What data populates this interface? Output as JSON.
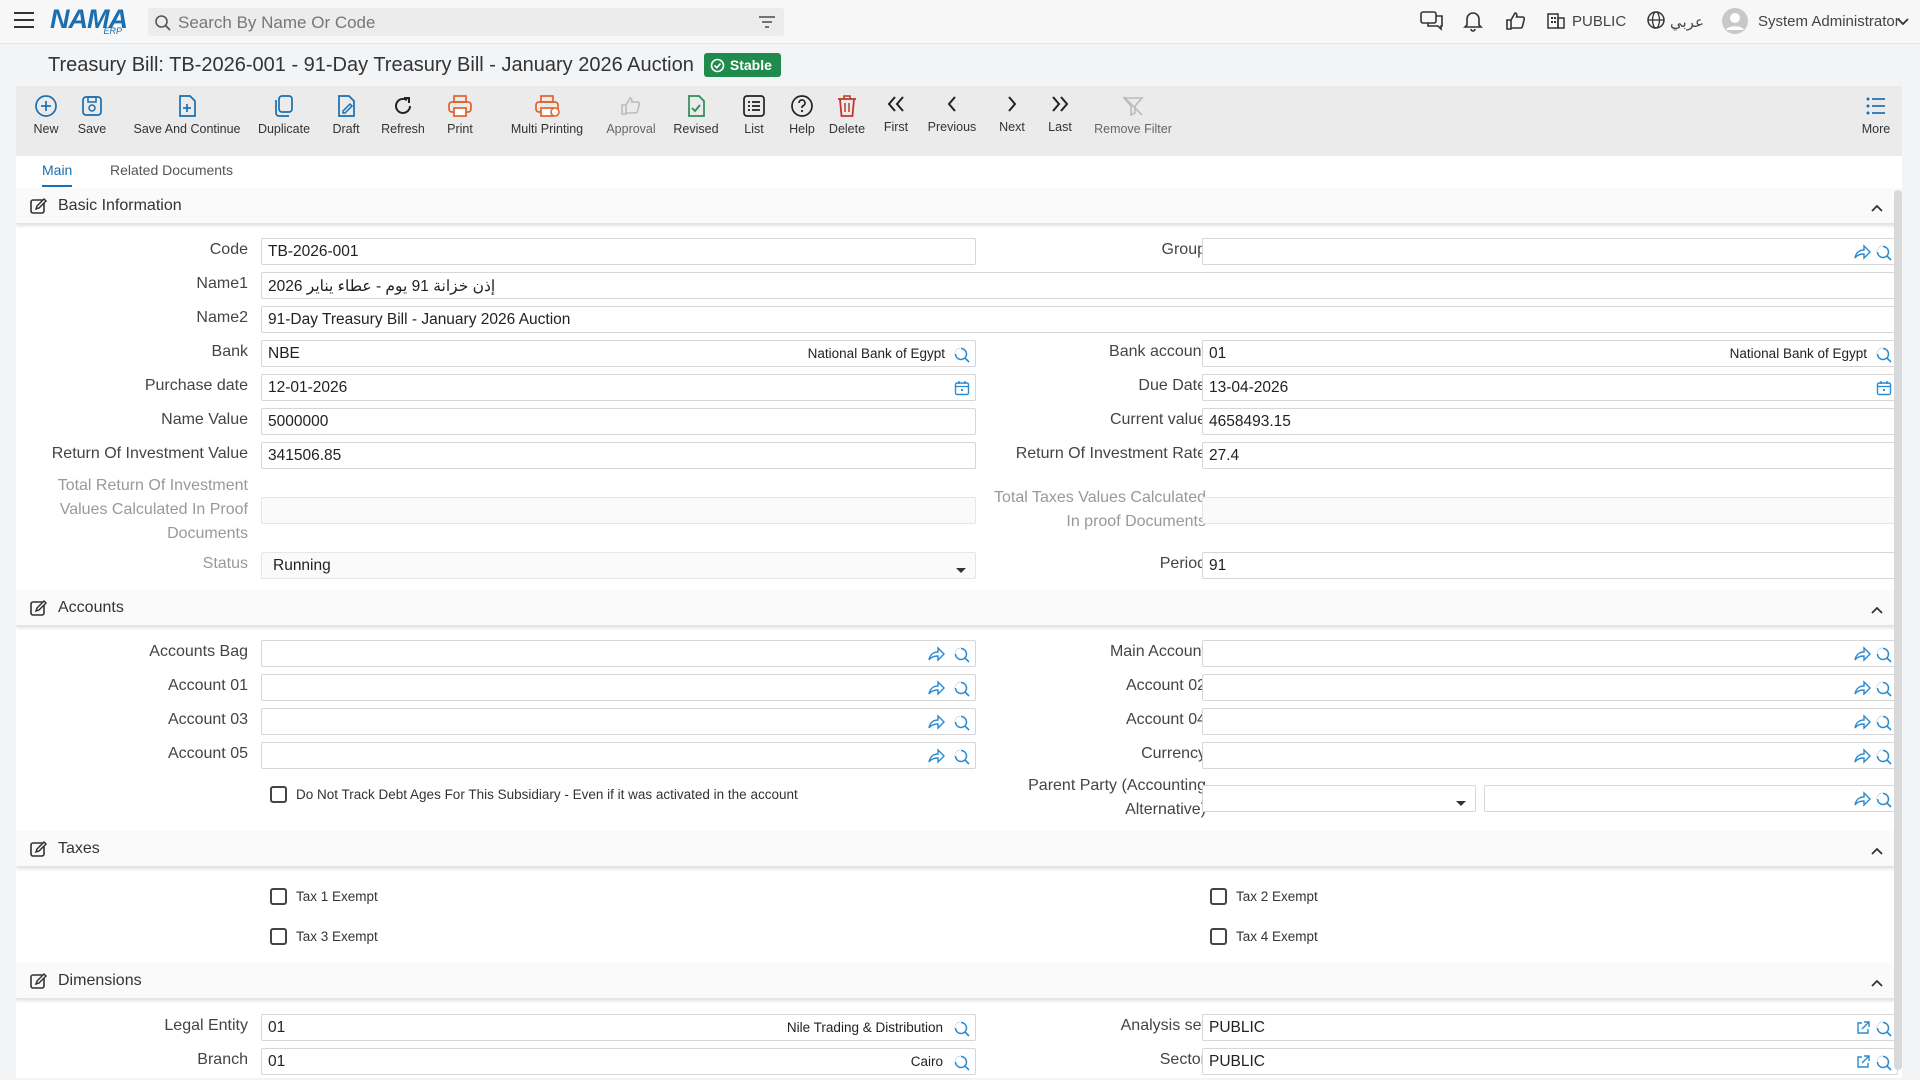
{
  "app": {
    "logo": "NAMA",
    "logo_sub": "ERP",
    "search_placeholder": "Search By Name Or Code",
    "company": "PUBLIC",
    "language": "عربي",
    "user": "System Administrator"
  },
  "page": {
    "title": "Treasury Bill: TB-2026-001 - 91-Day Treasury Bill - January 2026 Auction",
    "status_badge": "Stable",
    "status_color": "#1f8b4c"
  },
  "toolbar": {
    "new": "New",
    "save": "Save",
    "save_continue": "Save And Continue",
    "duplicate": "Duplicate",
    "draft": "Draft",
    "refresh": "Refresh",
    "print": "Print",
    "multi_printing": "Multi Printing",
    "approval": "Approval",
    "revised": "Revised",
    "list": "List",
    "help": "Help",
    "delete": "Delete",
    "first": "First",
    "previous": "Previous",
    "next": "Next",
    "last": "Last",
    "remove_filter": "Remove Filter",
    "more": "More"
  },
  "tabs": {
    "main": "Main",
    "related": "Related Documents"
  },
  "basic": {
    "title": "Basic Information",
    "code_label": "Code",
    "code": "TB-2026-001",
    "group_label": "Group",
    "group": "",
    "name1_label": "Name1",
    "name1": "إذن خزانة 91 يوم - عطاء يناير 2026",
    "name2_label": "Name2",
    "name2": "91-Day Treasury Bill - January 2026 Auction",
    "bank_label": "Bank",
    "bank": "NBE",
    "bank_desc": "National Bank of Egypt",
    "bank_account_label": "Bank account",
    "bank_account": "01",
    "bank_account_desc": "National Bank of Egypt",
    "purchase_date_label": "Purchase date",
    "purchase_date": "12-01-2026",
    "due_date_label": "Due Date",
    "due_date": "13-04-2026",
    "name_value_label": "Name Value",
    "name_value": "5000000",
    "current_value_label": "Current value",
    "current_value": "4658493.15",
    "roi_value_label": "Return Of Investment Value",
    "roi_value": "341506.85",
    "roi_rate_label": "Return Of Investment Rate",
    "roi_rate": "27.4",
    "total_roi_label_1": "Total Return Of Investment",
    "total_roi_label_2": "Values Calculated In Proof",
    "total_roi_label_3": "Documents",
    "total_roi": "",
    "total_taxes_label_1": "Total Taxes Values Calculated",
    "total_taxes_label_2": "In proof Documents",
    "total_taxes": "",
    "status_label": "Status",
    "status": "Running",
    "period_label": "Period",
    "period": "91"
  },
  "accounts": {
    "title": "Accounts",
    "accounts_bag_label": "Accounts Bag",
    "main_account_label": "Main Account",
    "account01_label": "Account 01",
    "account02_label": "Account 02",
    "account03_label": "Account 03",
    "account04_label": "Account 04",
    "account05_label": "Account 05",
    "currency_label": "Currency",
    "debt_ages_label": "Do Not Track Debt Ages For This Subsidiary - Even if it was activated in the account",
    "parent_party_label_1": "Parent Party (Accounting",
    "parent_party_label_2": "Alternative)"
  },
  "taxes": {
    "title": "Taxes",
    "tax1": "Tax 1 Exempt",
    "tax2": "Tax 2 Exempt",
    "tax3": "Tax 3 Exempt",
    "tax4": "Tax 4 Exempt"
  },
  "dimensions": {
    "title": "Dimensions",
    "legal_entity_label": "Legal Entity",
    "legal_entity": "01",
    "legal_entity_desc": "Nile Trading & Distribution",
    "analysis_set_label": "Analysis set",
    "analysis_set": "PUBLIC",
    "branch_label": "Branch",
    "branch": "01",
    "branch_desc": "Cairo",
    "sector_label": "Sector",
    "sector": "PUBLIC"
  },
  "colors": {
    "accent": "#1a6fb0",
    "print_orange": "#e0622a",
    "delete_red": "#c0392b",
    "revised_green": "#2e8b57",
    "link_blue": "#2a8bd0"
  }
}
